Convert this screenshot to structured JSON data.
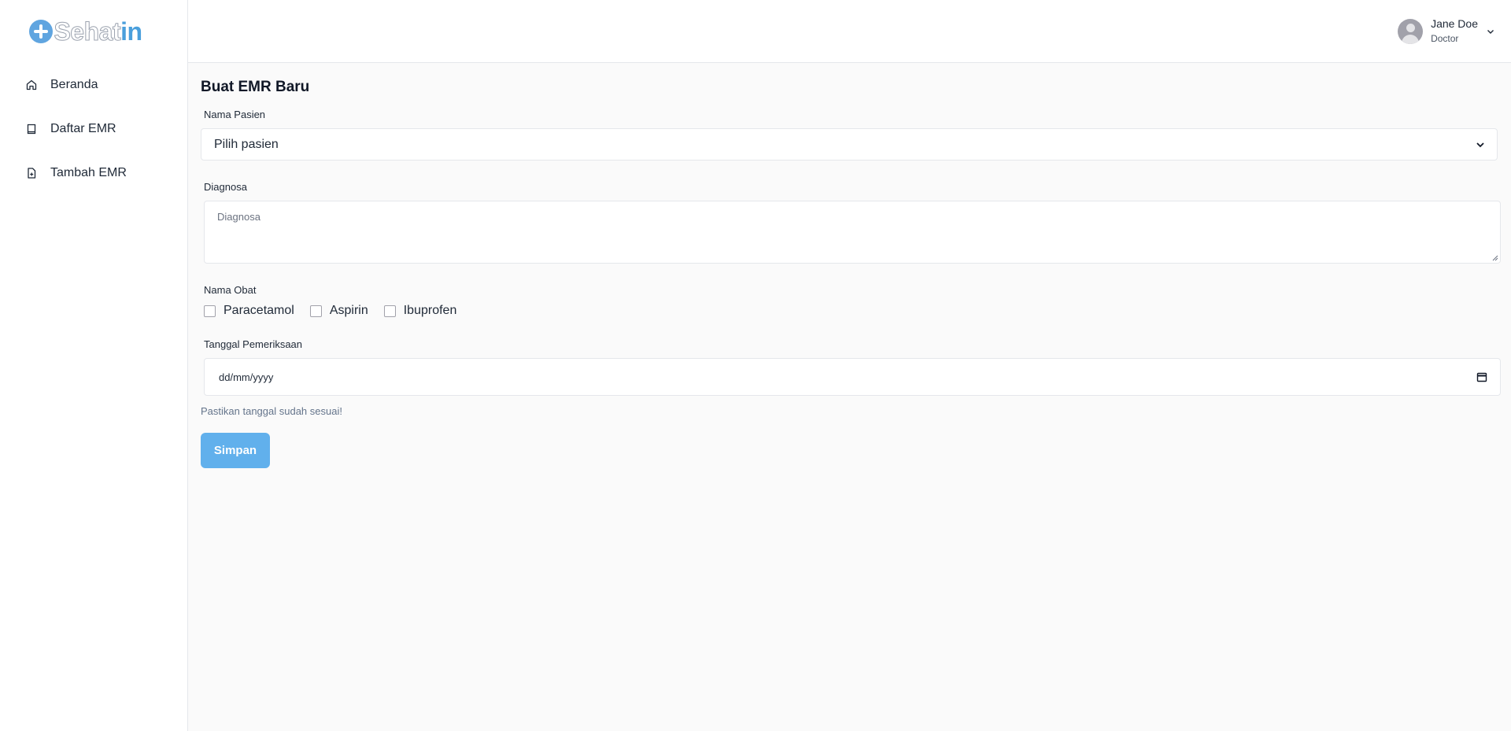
{
  "brand": {
    "name_part1": "Sehat",
    "name_part2": "in"
  },
  "sidebar": {
    "items": [
      {
        "label": "Beranda",
        "icon": "home-icon"
      },
      {
        "label": "Daftar EMR",
        "icon": "book-icon"
      },
      {
        "label": "Tambah EMR",
        "icon": "file-plus-icon"
      }
    ]
  },
  "user": {
    "name": "Jane Doe",
    "role": "Doctor"
  },
  "page": {
    "title": "Buat EMR Baru"
  },
  "form": {
    "patient": {
      "label": "Nama Pasien",
      "selected": "Pilih pasien"
    },
    "diagnosis": {
      "label": "Diagnosa",
      "placeholder": "Diagnosa"
    },
    "medicine": {
      "label": "Nama Obat",
      "options": [
        "Paracetamol",
        "Aspirin",
        "Ibuprofen"
      ]
    },
    "date": {
      "label": "Tanggal Pemeriksaan",
      "placeholder": "dd/mm/yyyy"
    },
    "helper": "Pastikan tanggal sudah sesuai!",
    "submit_label": "Simpan"
  },
  "colors": {
    "brand_primary": "#4a9fdc",
    "button": "#61b0ec",
    "border": "#e5e7eb"
  }
}
